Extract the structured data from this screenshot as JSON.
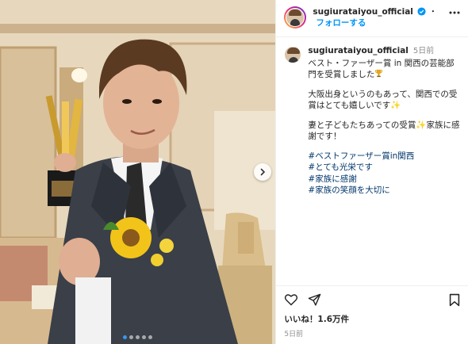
{
  "post": {
    "username": "sugiurataiyou_official",
    "follow_label": "フォローする",
    "time_ago": "5日前",
    "caption": {
      "line1": "ベスト・ファーザー賞 in 関西の芸能部門を受賞しました",
      "line2": "大阪出身というのもあって、関西での受賞はとても嬉しいです",
      "line3": "妻と子どもたちあっての受賞",
      "line3b": "家族に感謝です！",
      "hashtags": [
        "#ベストファーザー賞in関西",
        "#とても光栄です",
        "#家族に感謝",
        "#家族の笑顔を大切に"
      ]
    },
    "likes_text": "いいね！1.6万件",
    "date_text": "5日前",
    "carousel": {
      "count": 5,
      "active_index": 0
    }
  },
  "colors": {
    "accent": "#0095f6",
    "hashtag": "#00376b",
    "dot_active": "#3897f0"
  },
  "icons": [
    "more-options-icon",
    "verified-icon",
    "trophy-icon",
    "like-icon",
    "share-icon",
    "save-icon",
    "carousel-next-icon"
  ]
}
